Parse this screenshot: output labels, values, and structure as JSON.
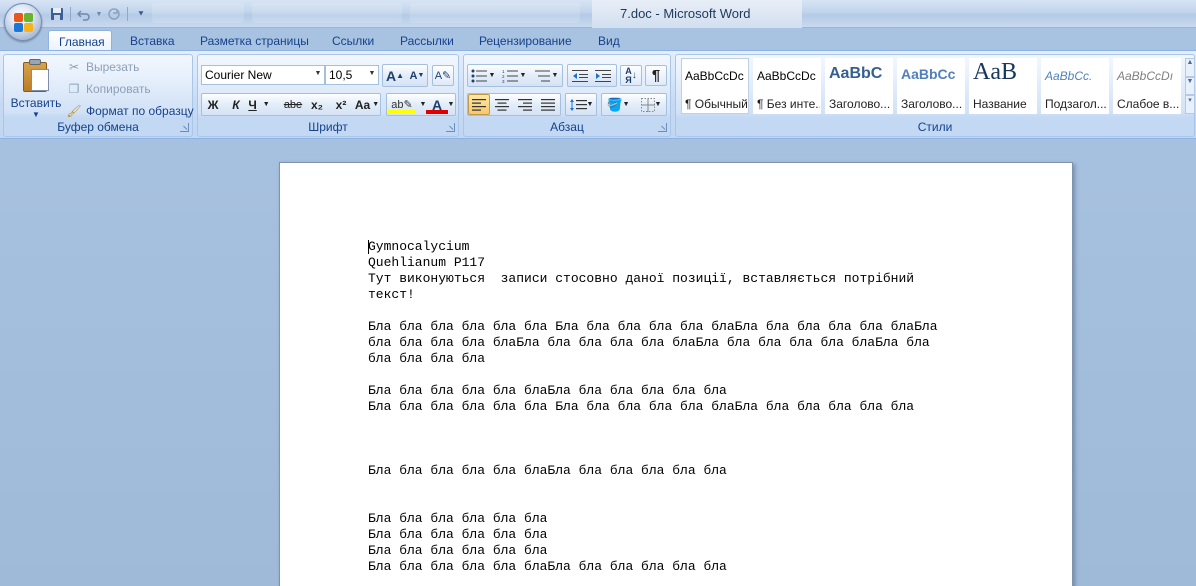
{
  "window": {
    "title": "7.doc - Microsoft Word",
    "background_windows": [
      "",
      "",
      ""
    ]
  },
  "quick_access": {
    "icons": [
      "save-icon",
      "undo-icon",
      "redo-icon",
      "customize-icon"
    ]
  },
  "tabs": [
    {
      "label": "Главная",
      "active": true
    },
    {
      "label": "Вставка"
    },
    {
      "label": "Разметка страницы"
    },
    {
      "label": "Ссылки"
    },
    {
      "label": "Рассылки"
    },
    {
      "label": "Рецензирование"
    },
    {
      "label": "Вид"
    }
  ],
  "clipboard": {
    "group_label": "Буфер обмена",
    "paste_label": "Вставить",
    "cut_label": "Вырезать",
    "copy_label": "Копировать",
    "format_painter_label": "Формат по образцу"
  },
  "font": {
    "group_label": "Шрифт",
    "font_name": "Courier New",
    "font_size": "10,5",
    "grow": "A",
    "shrink": "A",
    "bold": "Ж",
    "italic": "К",
    "underline": "Ч",
    "strikethrough": "abe",
    "subscript": "x₂",
    "superscript": "x²",
    "change_case": "Aa",
    "highlight_color": "#ffff00",
    "font_color": "#e00000"
  },
  "paragraph": {
    "group_label": "Абзац"
  },
  "styles": {
    "group_label": "Стили",
    "items": [
      {
        "sample": "AaBbCcDc",
        "name": "¶ Обычный"
      },
      {
        "sample": "AaBbCcDc",
        "name": "¶ Без инте..."
      },
      {
        "sample": "AaBbC",
        "name": "Заголово..."
      },
      {
        "sample": "AaBbCc",
        "name": "Заголово..."
      },
      {
        "sample": "AaB",
        "name": "Название"
      },
      {
        "sample": "AaBbCc.",
        "name": "Подзагол..."
      },
      {
        "sample": "AaBbCcDı",
        "name": "Слабое в..."
      }
    ]
  },
  "document": {
    "lines": [
      "Gymnocalycium",
      "Quehlianum P117",
      "Тут виконуються  записи стосовно даної позиції, вставляється потрібний",
      "текст!",
      "",
      "Бла бла бла бла бла бла Бла бла бла бла бла блаБла бла бла бла бла блаБла",
      "бла бла бла бла блаБла бла бла бла бла блаБла бла бла бла бла блаБла бла",
      "бла бла бла бла",
      "",
      "Бла бла бла бла бла блаБла бла бла бла бла бла",
      "Бла бла бла бла бла бла Бла бла бла бла бла блаБла бла бла бла бла бла",
      "",
      "",
      "",
      "Бла бла бла бла бла блаБла бла бла бла бла бла",
      "",
      "",
      "Бла бла бла бла бла бла",
      "Бла бла бла бла бла бла",
      "Бла бла бла бла бла бла",
      "Бла бла бла бла бла блаБла бла бла бла бла бла"
    ]
  }
}
